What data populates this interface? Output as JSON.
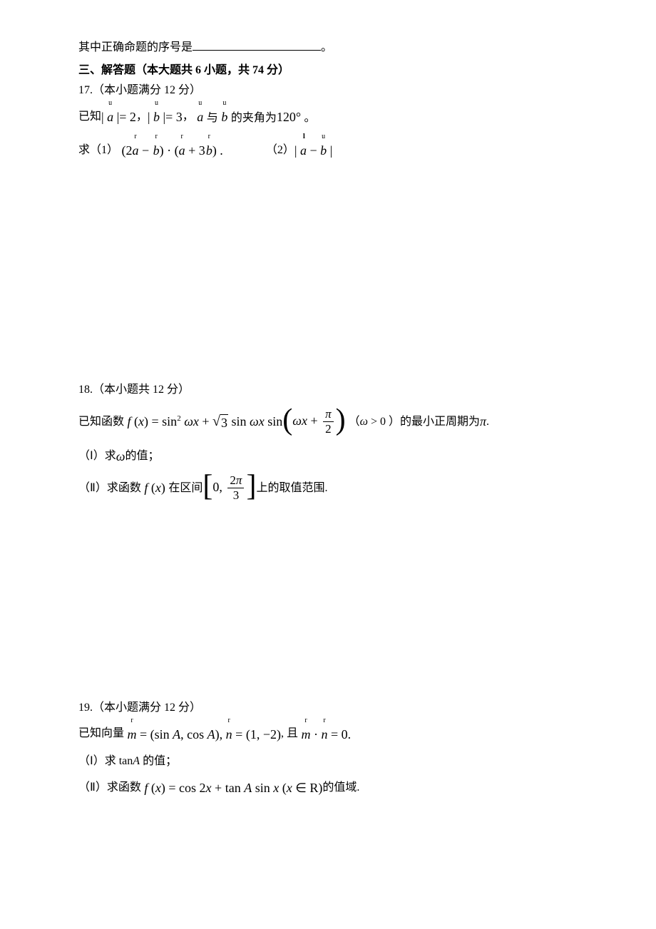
{
  "top_line_prefix": "其中正确命题的序号是",
  "top_line_suffix": "。",
  "section_header": "三、解答题（本大题共 6 小题，共 74 分）",
  "q17": {
    "head": "17.（本小题满分 12 分）",
    "given_prefix": "已知",
    "given_a_eq": "| a | = 2",
    "given_sep1": "，",
    "given_b_eq": "| b | = 3",
    "given_sep2": "，",
    "given_angle_prefix": "a",
    "given_angle_mid": "与",
    "given_angle_suffix": "b",
    "given_angle_tail": "的夹角为",
    "given_angle_value": "120°",
    "given_period": "。",
    "ask_prefix": "求（1）",
    "expr1_l": "(2a − b) · (a + 3b) .",
    "ask2": "（2）",
    "expr2": "| a − b |"
  },
  "q18": {
    "head": "18.（本小题共 12 分）",
    "given_prefix": "已知函数",
    "func_label": "f (x) = sin",
    "sq": "2",
    "omega_x": "ωx + ",
    "sqrt3": "3",
    "sin_omega_sin": " sin ωx sin",
    "inner_omega": "ωx + ",
    "pi": "π",
    "two": "2",
    "cond_prefix": "（",
    "cond_omega": "ω > 0",
    "cond_suffix": "）的最小正周期为",
    "pi_sym": "π",
    "period": ".",
    "part1": "（Ⅰ）求",
    "part1_omega": "ω",
    "part1_tail": "的值；",
    "part2": "（Ⅱ）求函数",
    "part2_func": "f (x)",
    "part2_mid": "在区间",
    "interval_l": "0,",
    "interval_num": "2π",
    "interval_den": "3",
    "part2_tail": "上的取值范围."
  },
  "q19": {
    "head": "19.（本小题满分 12 分）",
    "given_prefix": "已知向量",
    "m_eq": "m = (sin A, cos A),",
    "n_eq": "n = (1, −2)",
    "given_mid": ", 且",
    "mn_eq": "m · n = 0.",
    "part1": "（Ⅰ）求 tanA 的值；",
    "part2_prefix": "（Ⅱ）求函数",
    "part2_func": "f (x) = cos 2x + tan A sin x (x ∈ R)",
    "part2_tail": "的值域."
  }
}
